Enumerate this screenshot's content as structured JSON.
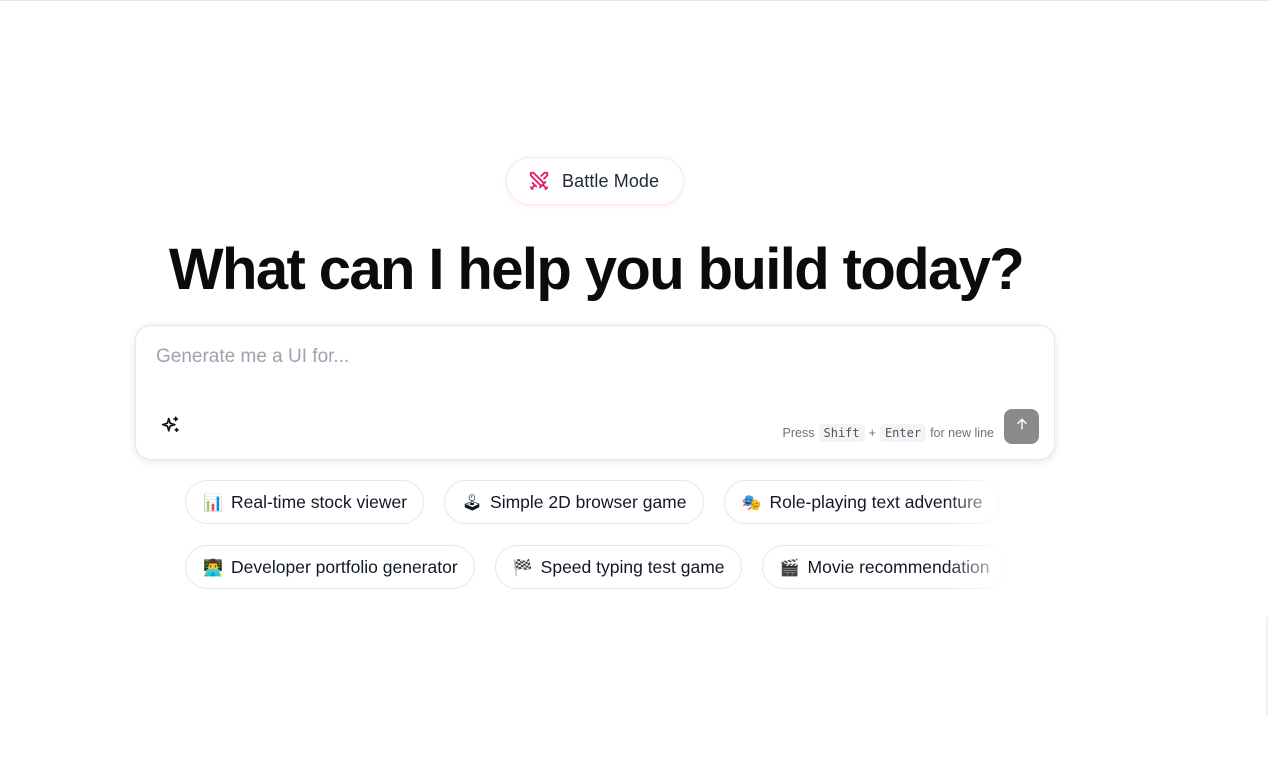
{
  "battle_mode": {
    "label": "Battle Mode",
    "icon": "crossed-swords-icon",
    "accent_color": "#e11d74"
  },
  "headline": "What can I help you build today?",
  "prompt": {
    "placeholder": "Generate me a UI for...",
    "value": "",
    "hint_prefix": "Press",
    "hint_key_1": "Shift",
    "hint_plus": "+",
    "hint_key_2": "Enter",
    "hint_suffix": "for new line",
    "sparkle_icon": "sparkle-icon",
    "send_icon": "arrow-up-icon",
    "send_button_color": "#8a8a8a"
  },
  "suggestions": {
    "row1": [
      {
        "emoji": "📊",
        "icon": "bar-chart-icon",
        "label": "Real-time stock viewer"
      },
      {
        "emoji": "🕹",
        "icon": "joystick-icon",
        "label": "Simple 2D browser game"
      },
      {
        "emoji": "🎭",
        "icon": "theater-masks-icon",
        "label": "Role-playing text adventure"
      }
    ],
    "row2": [
      {
        "emoji": "👨‍💻",
        "icon": "developer-icon",
        "label": "Developer portfolio generator"
      },
      {
        "emoji": "🏁",
        "icon": "checkered-flag-icon",
        "label": "Speed typing test game"
      },
      {
        "emoji": "🎬",
        "icon": "clapper-board-icon",
        "label": "Movie recommendation"
      }
    ]
  }
}
